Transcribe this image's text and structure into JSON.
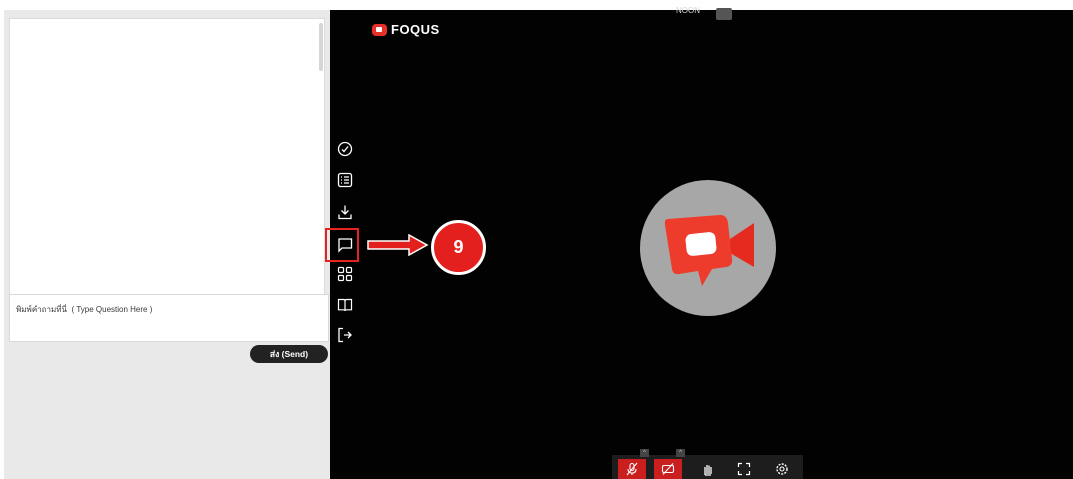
{
  "chat": {
    "input_placeholder": "พิมพ์คำถามที่นี่  ( Type Question Here )",
    "send_label": "ส่ง (Send)"
  },
  "header": {
    "brand_name": "FOQUS",
    "time_label": "NOON"
  },
  "toolbar": {
    "items": [
      "poll-icon",
      "list-icon",
      "download-icon",
      "chat-icon",
      "grid-icon",
      "book-icon",
      "exit-icon"
    ],
    "highlighted": "chat-icon"
  },
  "callout": {
    "step_number": "9"
  },
  "controls": {
    "items": [
      "mic-off-icon",
      "camera-off-icon",
      "raise-hand-icon",
      "fullscreen-icon",
      "settings-icon"
    ]
  },
  "colors": {
    "accent_red": "#e3201e",
    "stage_background": "#020202",
    "panel_background": "#e9e9e9"
  }
}
